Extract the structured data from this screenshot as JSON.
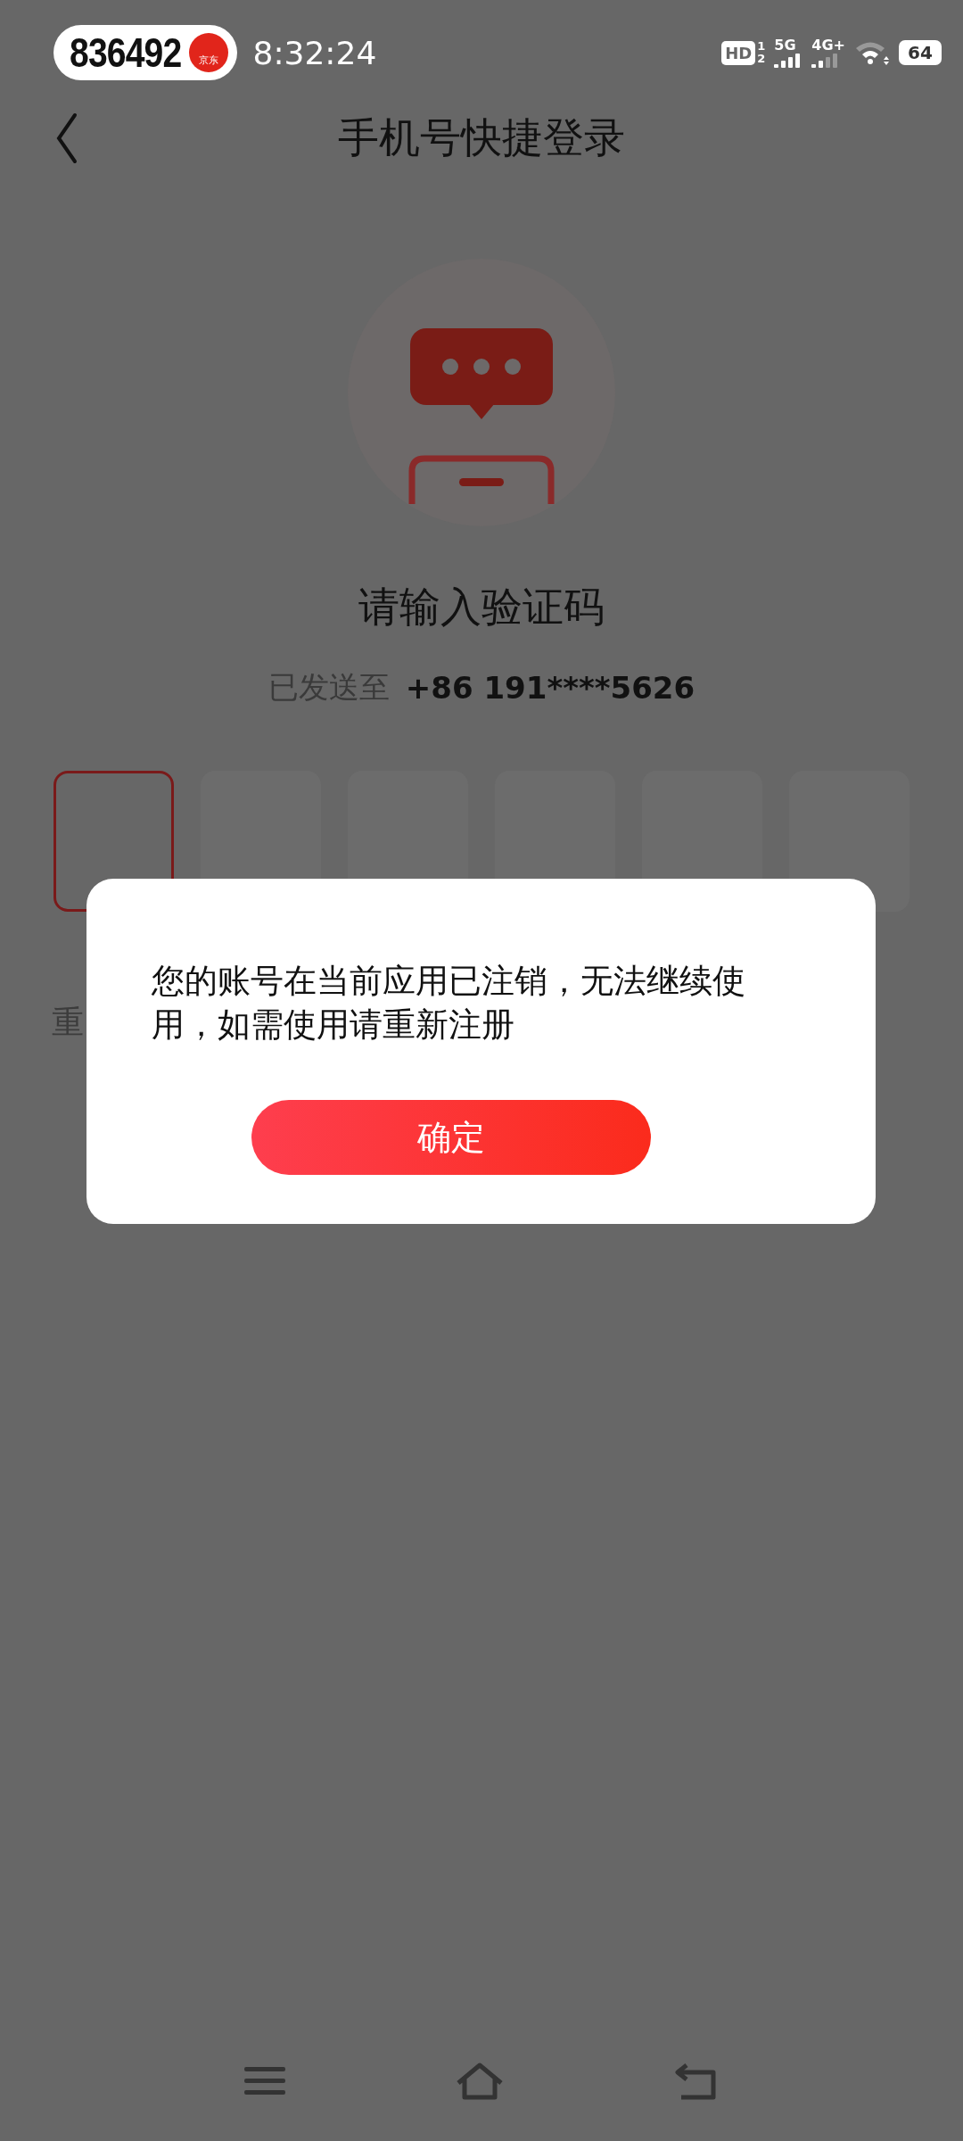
{
  "status_bar": {
    "pill_number": "836492",
    "pill_badge": "京东",
    "time": "8:32:24",
    "hd_label": "HD",
    "sim_labels": [
      "1",
      "2"
    ],
    "networks": [
      {
        "label": "5G"
      },
      {
        "label": "4G+"
      }
    ],
    "battery": "64"
  },
  "header": {
    "title": "手机号快捷登录"
  },
  "heading": "请输入验证码",
  "sent_label": "已发送至",
  "phone": "+86 191****5626",
  "code_boxes": [
    {
      "selected": true
    },
    {
      "selected": false
    },
    {
      "selected": false
    },
    {
      "selected": false
    },
    {
      "selected": false
    },
    {
      "selected": false
    }
  ],
  "resend_partial": "重",
  "dialog": {
    "message": "您的账号在当前应用已注销，无法继续使用，如需使用请重新注册",
    "button": "确定"
  }
}
